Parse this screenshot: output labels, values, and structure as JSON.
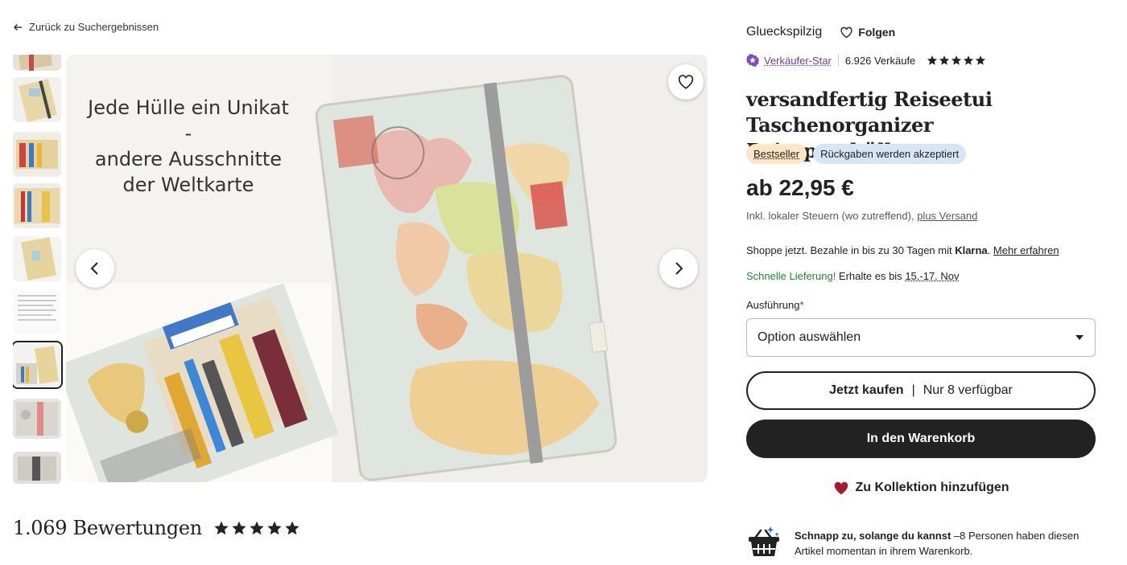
{
  "back_link": {
    "label": "Zurück zu Suchergebnissen"
  },
  "gallery": {
    "overlay_lines": [
      "Jede Hülle ein Unikat -",
      "andere Ausschnitte",
      "der Weltkarte"
    ],
    "favorite_icon": "heart-outline-icon",
    "prev_icon": "chevron-left-icon",
    "next_icon": "chevron-right-icon",
    "thumbnails_count": 9,
    "active_thumbnail_index": 6
  },
  "reviews": {
    "count_label": "1.069 Bewertungen",
    "rating": 5
  },
  "shop": {
    "name": "Glueckspilzig",
    "follow_label": "Folgen",
    "star_seller_label": "Verkäufer-Star",
    "sales_label": "6.926 Verkäufe",
    "rating": 5
  },
  "listing": {
    "title": "versandfertig Reiseetui Taschenorganizer Reisepasshülle",
    "badges": [
      "Bestseller",
      "Rückgaben werden akzeptiert"
    ],
    "price": "ab 22,95 €",
    "tax_text": "Inkl. lokaler Steuern (wo zutreffend), ",
    "shipping_link": "plus Versand"
  },
  "klarna": {
    "text": "Shoppe jetzt. Bezahle in bis zu 30 Tagen mit ",
    "brand": "Klarna",
    "link": "Mehr erfahren"
  },
  "delivery": {
    "fast_label": "Schnelle Lieferung!",
    "text": " Erhalte es bis ",
    "dates": "15.-17. Nov"
  },
  "variant": {
    "label": "Ausführung",
    "required_mark": "*",
    "selected": "Option auswählen"
  },
  "buttons": {
    "buy_now": "Jetzt kaufen",
    "buy_now_sep": "|",
    "availability": "Nur 8 verfügbar",
    "add_to_cart": "In den Warenkorb",
    "add_to_collection": "Zu Kollektion hinzufügen"
  },
  "scarcity": {
    "bold": "Schnapp zu, solange du kannst",
    "text": " –8 Personen haben diesen Artikel momentan in ihrem Warenkorb."
  },
  "colors": {
    "primary": "#222222",
    "star_seller": "#6b3fa0",
    "fast_delivery": "#258635",
    "bestseller_bg": "#fde7c7",
    "returns_bg": "#d7e6f5",
    "heart": "#a61a2e"
  }
}
